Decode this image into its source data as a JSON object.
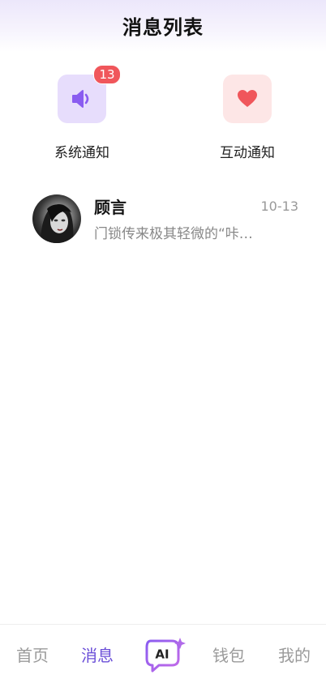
{
  "header": {
    "title": "消息列表"
  },
  "notifications": [
    {
      "label": "系统通知",
      "badge": "13",
      "icon": "speaker-icon",
      "color": "#8a5cf0"
    },
    {
      "label": "互动通知",
      "icon": "heart-icon",
      "color": "#f0565b"
    }
  ],
  "messages": [
    {
      "name": "顾言",
      "time": "10-13",
      "preview": "门锁传来极其轻微的“咔…"
    }
  ],
  "tabbar": {
    "items": [
      {
        "label": "首页"
      },
      {
        "label": "消息",
        "active": true
      },
      {
        "label": "AI",
        "icon": "ai-chat-icon"
      },
      {
        "label": "钱包"
      },
      {
        "label": "我的"
      }
    ],
    "active_color": "#6b4fd8",
    "inactive_color": "#9a9a9a"
  }
}
